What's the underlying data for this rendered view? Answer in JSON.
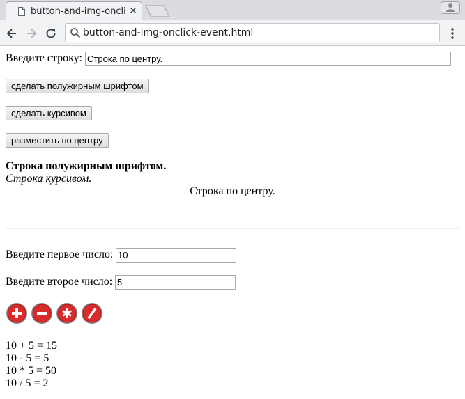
{
  "browser": {
    "tab_title": "button-and-img-onclick-event.html",
    "address": "button-and-img-onclick-event.html"
  },
  "icons": {
    "page": "document-icon",
    "tab_close": "close-icon",
    "back": "back-arrow-icon",
    "forward": "forward-arrow-icon",
    "reload": "reload-icon",
    "search": "search-icon",
    "menu": "kebab-menu-icon",
    "profile": "profile-icon",
    "add": "plus-circle-icon",
    "subtract": "minus-circle-icon",
    "multiply": "asterisk-circle-icon",
    "divide": "slash-circle-icon"
  },
  "colors": {
    "op_button_red": "#d92b2b"
  },
  "text_section": {
    "label": "Введите строку:",
    "input_value": "Строка по центру.",
    "bold_button": "сделать полужирным шрифтом",
    "italic_button": "сделать курсивом",
    "center_button": "разместить по центру",
    "bold_output": "Строка полужирным шрифтом.",
    "italic_output": "Строка курсивом.",
    "center_output": "Строка по центру."
  },
  "calc_section": {
    "first_label": "Введите первое число:",
    "first_value": "10",
    "second_label": "Введите второе число:",
    "second_value": "5",
    "results": [
      "10 + 5 = 15",
      "10 - 5 = 5",
      "10 * 5 = 50",
      "10 / 5 = 2"
    ]
  }
}
